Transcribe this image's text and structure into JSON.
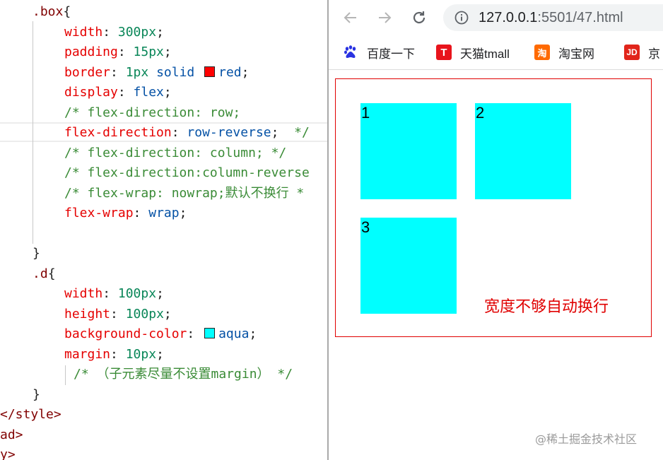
{
  "editor": {
    "lines": {
      "l1": {
        "sel": ".box",
        "p": "{"
      },
      "l2": {
        "prop": "width",
        "val": "300px"
      },
      "l3": {
        "prop": "padding",
        "val": "15px"
      },
      "l4": {
        "prop": "border",
        "v1": "1px",
        "v2": "solid",
        "v3": "red"
      },
      "l5": {
        "prop": "display",
        "val": "flex"
      },
      "l6": {
        "comment": "/* flex-direction: row;"
      },
      "l7": {
        "prop": "flex-direction",
        "val": "row-reverse",
        "tail": "*/"
      },
      "l8": {
        "comment": "/* flex-direction: column; */"
      },
      "l9": {
        "comment": "/* flex-direction:column-reverse"
      },
      "l10": {
        "comment": "/* flex-wrap: nowrap;默认不换行 *"
      },
      "l11": {
        "prop": "flex-wrap",
        "val": "wrap"
      },
      "l12": {
        "p": "}"
      },
      "l13": {
        "sel": ".d",
        "p": "{"
      },
      "l14": {
        "prop": "width",
        "val": "100px"
      },
      "l15": {
        "prop": "height",
        "val": "100px"
      },
      "l16": {
        "prop": "background-color",
        "val": "aqua"
      },
      "l17": {
        "prop": "margin",
        "val": "10px"
      },
      "l18": {
        "comment": "/* （子元素尽量不设置margin） */"
      },
      "l19": {
        "p": "}"
      },
      "l20": {
        "tag": "</style>"
      },
      "l21": {
        "tag": "ad>"
      },
      "l22": {
        "tag": "y>"
      }
    },
    "swatch_red": "#ff0000",
    "swatch_aqua": "#00ffff"
  },
  "browser": {
    "url_host": "127.0.0.1",
    "url_path": ":5501/47.html",
    "nav_icons": [
      "back-arrow-icon",
      "forward-arrow-icon",
      "reload-icon",
      "info-icon"
    ],
    "bookmarks": [
      {
        "label": "百度一下",
        "icon": "baidu-paw-icon"
      },
      {
        "label": "天猫tmall",
        "icon": "tmall-icon",
        "glyph": "T"
      },
      {
        "label": "淘宝网",
        "icon": "taobao-icon",
        "glyph": "淘"
      },
      {
        "label": "京",
        "icon": "jd-icon",
        "glyph": "JD"
      }
    ],
    "page": {
      "items": [
        "1",
        "2",
        "3"
      ],
      "note": "宽度不够自动换行",
      "border_color": "#e00000",
      "item_color": "#00ffff"
    }
  },
  "watermark": "@稀土掘金技术社区"
}
